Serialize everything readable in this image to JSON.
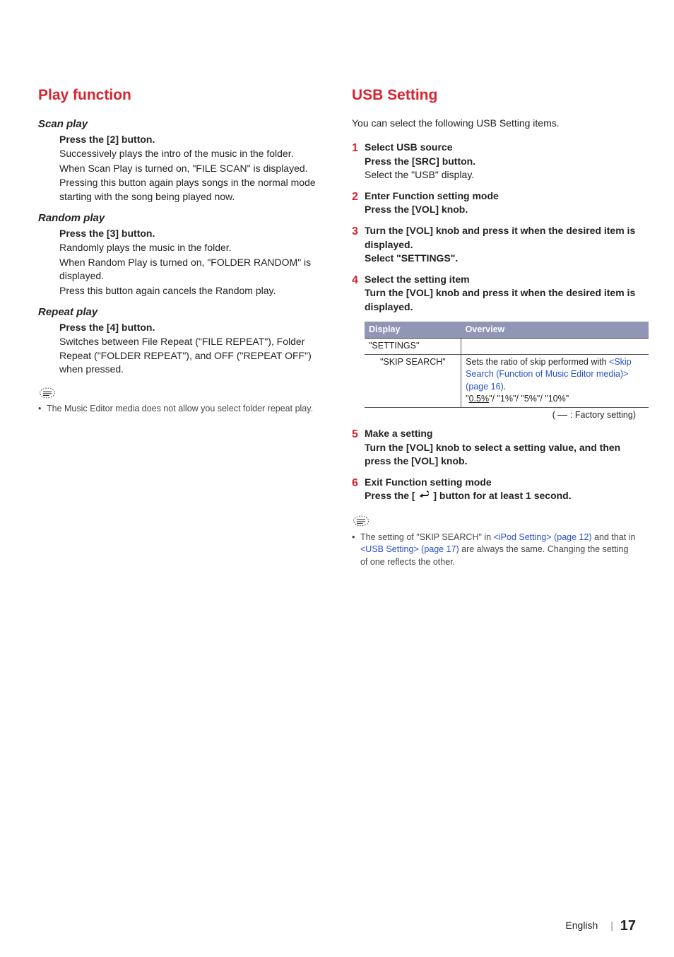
{
  "left": {
    "title": "Play function",
    "scan": {
      "heading": "Scan play",
      "press": "Press the [2] button.",
      "l1": "Successively plays the intro of the music in the folder.",
      "l2": "When Scan Play is turned on, \"FILE SCAN\" is displayed.",
      "l3": "Pressing this button again plays songs in the normal mode starting with the song being played now."
    },
    "random": {
      "heading": "Random play",
      "press": "Press the [3] button.",
      "l1": "Randomly plays the music in the folder.",
      "l2": "When Random Play is turned on, \"FOLDER RANDOM\" is displayed.",
      "l3": "Press this button again cancels the Random play."
    },
    "repeat": {
      "heading": "Repeat play",
      "press": "Press the [4] button.",
      "l1": "Switches between File Repeat (\"FILE REPEAT\"), Folder Repeat (\"FOLDER REPEAT\"), and OFF (\"REPEAT OFF\") when pressed."
    },
    "note": "The Music Editor media does not allow you select folder repeat play."
  },
  "right": {
    "title": "USB Setting",
    "intro": "You can select the following USB Setting items.",
    "steps": {
      "s1": {
        "num": "1",
        "title": "Select USB source",
        "sub": "Press the [SRC] button.",
        "text": "Select the \"USB\" display."
      },
      "s2": {
        "num": "2",
        "title": "Enter Function setting mode",
        "sub": "Press the [VOL] knob."
      },
      "s3": {
        "num": "3",
        "title": "Turn the [VOL] knob and press it when the desired item is displayed.",
        "sub": "Select \"SETTINGS\"."
      },
      "s4": {
        "num": "4",
        "title": "Select the setting item",
        "sub": "Turn the [VOL] knob and press it when the desired item is displayed."
      },
      "s5": {
        "num": "5",
        "title": "Make a setting",
        "sub": "Turn the [VOL] knob to select a setting value, and then press the [VOL] knob."
      },
      "s6": {
        "num": "6",
        "title": "Exit Function setting mode",
        "sub_prefix": "Press the [",
        "sub_suffix": "] button for at least 1 second."
      }
    },
    "table": {
      "h1": "Display",
      "h2": "Overview",
      "row1": {
        "display": "\"SETTINGS\"",
        "overview": ""
      },
      "row2": {
        "display": "\"SKIP SEARCH\"",
        "ov1": "Sets the ratio of skip performed with ",
        "ov_link1": "<Skip Search (Function of Music Editor media)> (page 16)",
        "ov2": ".",
        "ov3_prefix": "\"",
        "ov3_under": "0.5%",
        "ov3_suffix": "\"/ \"1%\"/ \"5%\"/ \"10%\""
      }
    },
    "factory": ": Factory setting)",
    "note_prefix": "The setting of \"SKIP SEARCH\" in ",
    "note_link1": "<iPod Setting> (page 12)",
    "note_mid": " and that in ",
    "note_link2": "<USB Setting> (page 17)",
    "note_suffix": " are always the same. Changing the setting of one reflects the other."
  },
  "footer": {
    "lang": "English",
    "sep": "|",
    "page": "17"
  }
}
